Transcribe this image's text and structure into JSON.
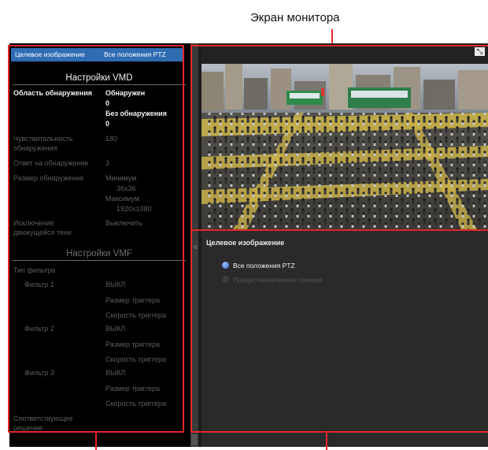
{
  "callout": {
    "title": "Экран монитора"
  },
  "left": {
    "target": {
      "label": "Целевое изображение",
      "value": "Все положения PTZ"
    },
    "vmd": {
      "title": "Настройки VMD",
      "area": {
        "label": "Область обнаружения",
        "lines": [
          "Обнаружен",
          "0",
          "Без обнаружения",
          "0"
        ]
      },
      "sensitivity": {
        "label": [
          "Чувствительность",
          "обнаружения"
        ],
        "value": "180"
      },
      "response": {
        "label": "Ответ на обнаружение",
        "value": "3"
      },
      "size": {
        "label": "Размер обнаружения",
        "lines": [
          "Минимум",
          "36x36",
          "Максимум",
          "1920x1080"
        ]
      },
      "exclude": {
        "label": [
          "Исключение",
          "движущейся тени"
        ],
        "value": "Выключить"
      }
    },
    "vmf": {
      "title": "Настройки VMF",
      "filter_type": "Тип фильтра",
      "filters": [
        {
          "name": "Фильтр 1",
          "state": "ВЫКЛ",
          "size": "Размер триггера",
          "speed": "Скорость триггера"
        },
        {
          "name": "Фильтр 2",
          "state": "ВЫКЛ",
          "size": "Размер триггера",
          "speed": "Скорость триггера"
        },
        {
          "name": "Фильтр 3",
          "state": "ВЫКЛ",
          "size": "Размер триггера",
          "speed": "Скорость триггера"
        }
      ],
      "solution": [
        "Соответствующее",
        "решение"
      ]
    }
  },
  "right": {
    "panel": {
      "title": "Целевое изображение",
      "options": [
        {
          "label": "Все положения PTZ",
          "selected": true
        },
        {
          "label": "Предустановленная позиция",
          "selected": false
        }
      ]
    }
  },
  "icons": {
    "collapse": "«",
    "fullscreen": "⤡"
  }
}
